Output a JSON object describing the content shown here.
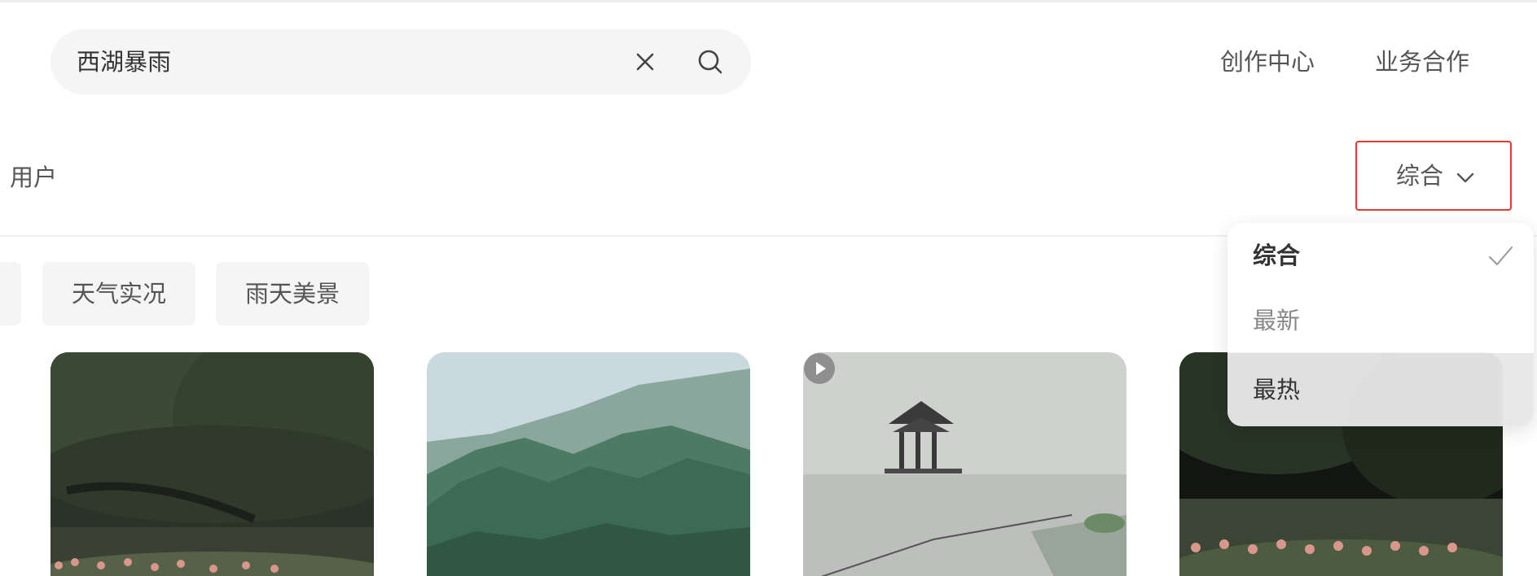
{
  "search": {
    "value": "西湖暴雨"
  },
  "header": {
    "links": [
      "创作中心",
      "业务合作"
    ]
  },
  "tabs": {
    "user_label": "用户"
  },
  "sort": {
    "selected": "综合",
    "options": [
      "综合",
      "最新",
      "最热"
    ],
    "highlighted": "最热"
  },
  "tags": [
    "天气实况",
    "雨天美景"
  ],
  "cards": [
    {
      "icon": "photo",
      "video": false
    },
    {
      "icon": "photo",
      "video": false
    },
    {
      "icon": "photo",
      "video": true
    },
    {
      "icon": "photo",
      "video": false
    }
  ],
  "colors": {
    "accent_border": "#e23b32",
    "chip_bg": "#f5f5f5",
    "search_bg": "#f5f5f5"
  }
}
